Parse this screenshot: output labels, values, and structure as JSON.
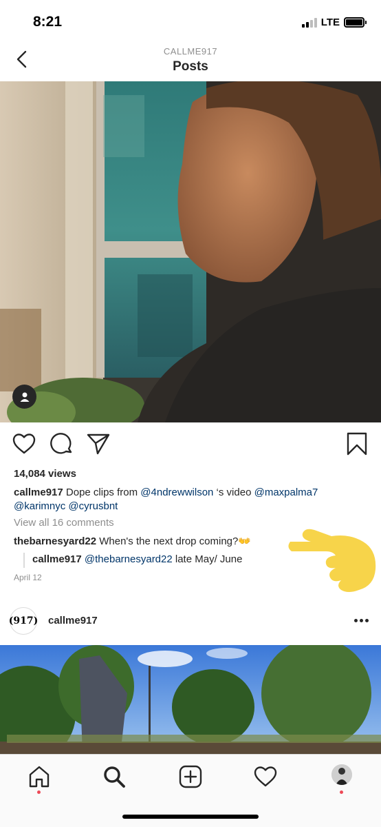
{
  "status_bar": {
    "time": "8:21",
    "network": "LTE"
  },
  "header": {
    "account": "CALLME917",
    "title": "Posts"
  },
  "post": {
    "views": "14,084 views",
    "caption": {
      "username": "callme917",
      "text_before": " Dope clips from ",
      "mention1": "@4ndrewwilson",
      "text_middle": " ‘s  video  ",
      "mention2": "@maxpalma7",
      "mention3": "@karimnyc",
      "mention4": "@cyrusbnt"
    },
    "view_all_comments": "View all 16 comments",
    "comments": [
      {
        "username": "thebarnesyard22",
        "text": " When's the next drop coming?👐"
      },
      {
        "username": "callme917",
        "mention": "@thebarnesyard22",
        "text": " late May/ June"
      }
    ],
    "date": "April 12"
  },
  "next_post": {
    "avatar_text": "(917)",
    "username": "callme917"
  },
  "icons": {
    "back": "chevron-left-icon",
    "like": "heart-icon",
    "comment": "comment-bubble-icon",
    "share": "paper-plane-icon",
    "save": "bookmark-icon",
    "tag": "person-icon",
    "more": "more-dots-icon",
    "home": "home-icon",
    "search": "search-icon",
    "add": "add-square-icon",
    "activity": "heart-icon",
    "overlay": "pointing-hand-emoji"
  },
  "colors": {
    "mention": "#003569",
    "notification_dot": "#ed4956",
    "muted": "#8e8e8e"
  }
}
